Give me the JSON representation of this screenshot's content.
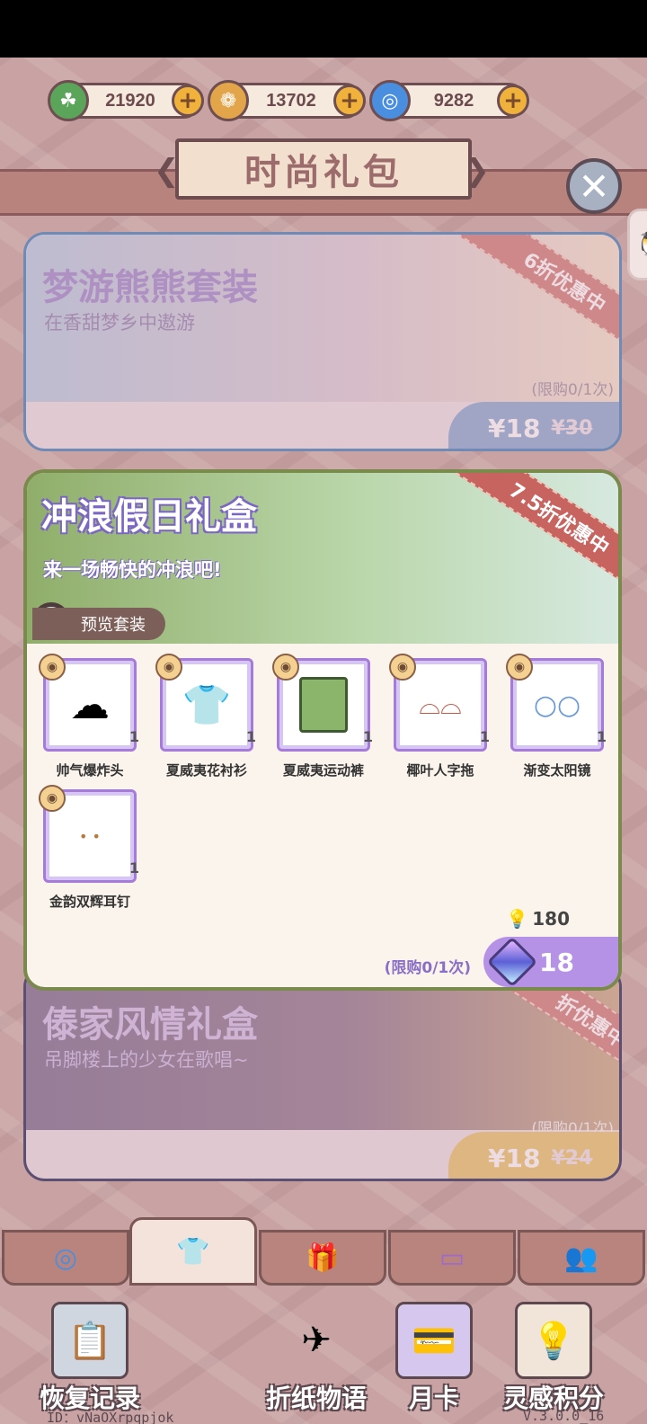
{
  "currencies": [
    {
      "icon": "clover-icon",
      "value": "21920",
      "color": "#5aa55a"
    },
    {
      "icon": "bell-coin-icon",
      "value": "13702",
      "color": "#e3a54a"
    },
    {
      "icon": "swirl-icon",
      "value": "9282",
      "color": "#4a8ee0"
    }
  ],
  "header": {
    "title": "时尚礼包",
    "close_icon": "✕"
  },
  "cards": [
    {
      "title": "梦游熊熊套装",
      "subtitle": "在香甜梦乡中遨游",
      "discount": "6折优惠中",
      "limit": "(限购0/1次)",
      "price": "¥18",
      "old_price": "¥30"
    },
    {
      "title": "冲浪假日礼盒",
      "subtitle": "来一场畅快的冲浪吧!",
      "discount": "7.5折优惠中",
      "preview_label": "预览套装",
      "limit": "(限购0/1次)",
      "inspiration": "180",
      "gem_price": "18",
      "items": [
        {
          "name": "帅气爆炸头",
          "qty": "1",
          "icon": "hair-icon"
        },
        {
          "name": "夏威夷花衬衫",
          "qty": "1",
          "icon": "shirt-icon"
        },
        {
          "name": "夏威夷运动裤",
          "qty": "1",
          "icon": "shorts-icon"
        },
        {
          "name": "椰叶人字拖",
          "qty": "1",
          "icon": "sandals-icon"
        },
        {
          "name": "渐变太阳镜",
          "qty": "1",
          "icon": "sunglasses-icon"
        },
        {
          "name": "金韵双辉耳钉",
          "qty": "1",
          "icon": "earring-icon"
        }
      ]
    },
    {
      "title": "傣家风情礼盒",
      "subtitle": "吊脚楼上的少女在歌唱~",
      "discount": "折优惠中",
      "limit": "(限购0/1次)",
      "price": "¥18",
      "old_price": "¥24"
    }
  ],
  "tabs": [
    {
      "icon": "swirl-tab-icon",
      "active": false
    },
    {
      "icon": "clothes-tab-icon",
      "active": true
    },
    {
      "icon": "gift-tab-icon",
      "active": false
    },
    {
      "icon": "card-tab-icon",
      "active": false
    },
    {
      "icon": "people-tab-icon",
      "active": false
    }
  ],
  "bottom_nav": [
    {
      "label": "恢复记录",
      "icon": "clipboard-icon"
    },
    {
      "label": "折纸物语",
      "icon": "paper-plane-icon"
    },
    {
      "label": "月卡",
      "icon": "card-icon"
    },
    {
      "label": "灵感积分",
      "icon": "lightbulb-icon"
    }
  ],
  "footer": {
    "id": "ID：vNaOXrpqpjok",
    "version": "V.3.0.0_16"
  }
}
